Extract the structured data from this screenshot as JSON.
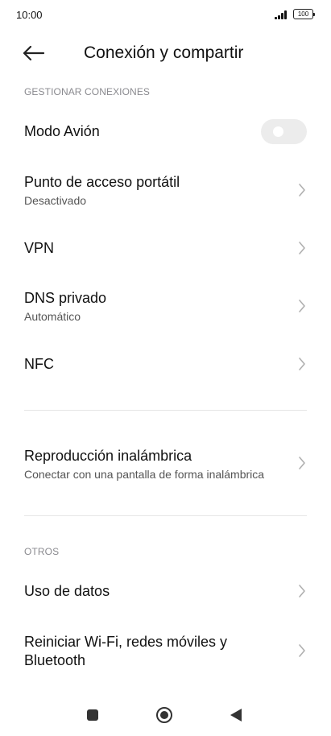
{
  "status_bar": {
    "time": "10:00",
    "battery": "100"
  },
  "header": {
    "title": "Conexión y compartir"
  },
  "sections": {
    "manage_label": "GESTIONAR CONEXIONES",
    "others_label": "OTROS"
  },
  "rows": {
    "airplane": {
      "title": "Modo Avión",
      "toggle_on": false
    },
    "hotspot": {
      "title": "Punto de acceso portátil",
      "subtitle": "Desactivado"
    },
    "vpn": {
      "title": "VPN"
    },
    "dns": {
      "title": "DNS privado",
      "subtitle": "Automático"
    },
    "nfc": {
      "title": "NFC"
    },
    "cast": {
      "title": "Reproducción inalámbrica",
      "subtitle": "Conectar con una pantalla de forma inalámbrica"
    },
    "data_usage": {
      "title": "Uso de datos"
    },
    "reset": {
      "title_line1": "Reiniciar Wi-Fi, redes móviles y",
      "title_line2": "Bluetooth"
    }
  },
  "colors": {
    "toggle_off": "#ececec",
    "chevron": "#b0b0b0",
    "section_label": "#8a8a8f"
  }
}
